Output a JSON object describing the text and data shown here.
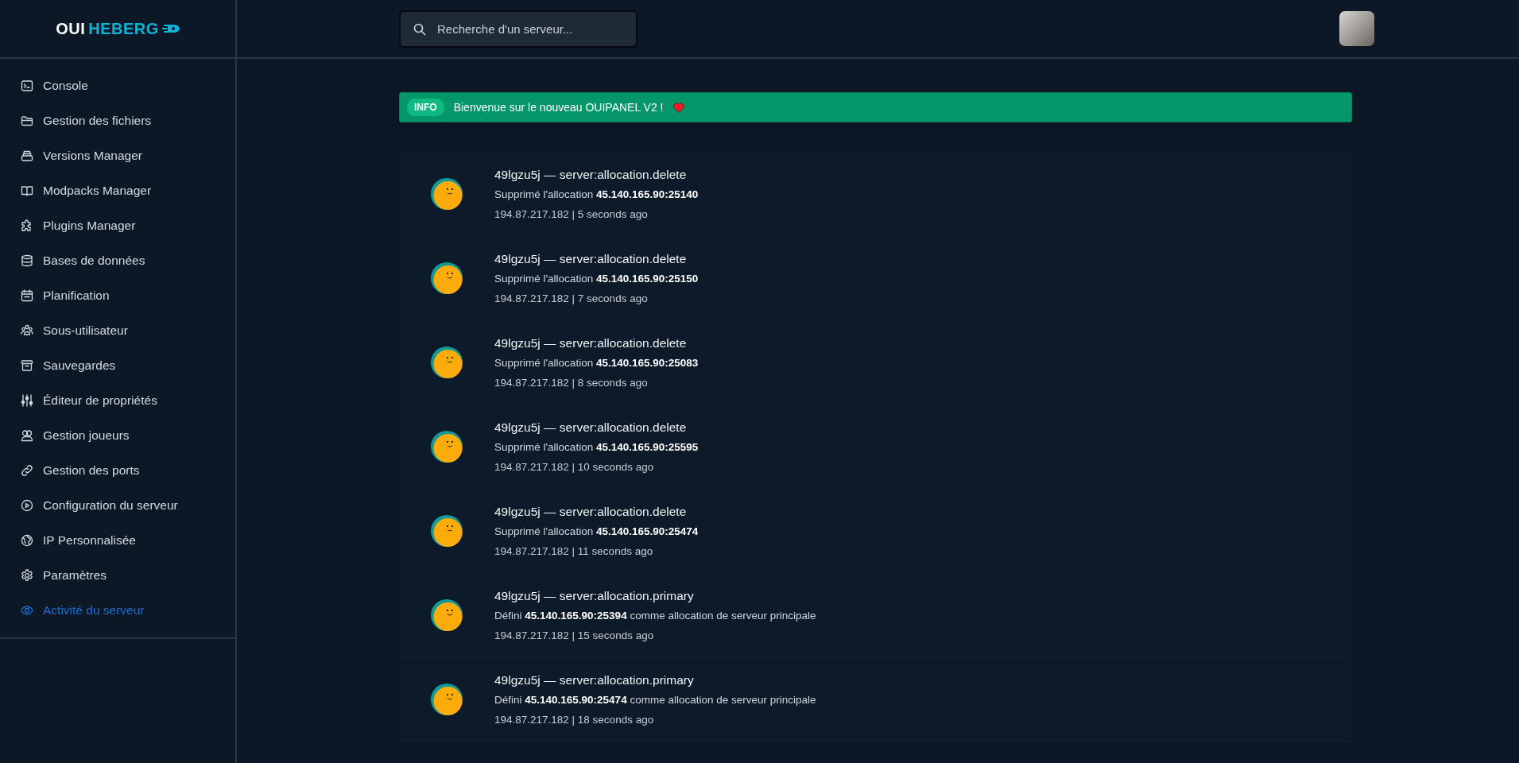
{
  "logo": {
    "part_1": "OUI",
    "part_2": "HEBERG"
  },
  "sidebar": {
    "items": [
      {
        "label": "Console",
        "selected": false
      },
      {
        "label": "Gestion des fichiers",
        "selected": false
      },
      {
        "label": "Versions Manager",
        "selected": false
      },
      {
        "label": "Modpacks Manager",
        "selected": false
      },
      {
        "label": "Plugins Manager",
        "selected": false
      },
      {
        "label": "Bases de données",
        "selected": false
      },
      {
        "label": "Planification",
        "selected": false
      },
      {
        "label": "Sous-utilisateur",
        "selected": false
      },
      {
        "label": "Sauvegardes",
        "selected": false
      },
      {
        "label": "Éditeur de propriétés",
        "selected": false
      },
      {
        "label": "Gestion joueurs",
        "selected": false
      },
      {
        "label": "Gestion des ports",
        "selected": false
      },
      {
        "label": "Configuration du serveur",
        "selected": false
      },
      {
        "label": "IP Personnalisée",
        "selected": false
      },
      {
        "label": "Paramètres",
        "selected": false
      },
      {
        "label": "Activité du serveur",
        "selected": true
      }
    ]
  },
  "search": {
    "placeholder": "Recherche d'un serveur..."
  },
  "alert": {
    "badge": "INFO",
    "message": "Bienvenue sur le nouveau OUIPANEL V2 !"
  },
  "activity": [
    {
      "title": "49lgzu5j — server:allocation.delete",
      "description": "Supprimé l'allocation **45.140.165.90:25140**",
      "meta": "194.87.217.182 | 5 seconds ago"
    },
    {
      "title": "49lgzu5j — server:allocation.delete",
      "description": "Supprimé l'allocation **45.140.165.90:25150**",
      "meta": "194.87.217.182 | 7 seconds ago"
    },
    {
      "title": "49lgzu5j — server:allocation.delete",
      "description": "Supprimé l'allocation **45.140.165.90:25083**",
      "meta": "194.87.217.182 | 8 seconds ago"
    },
    {
      "title": "49lgzu5j — server:allocation.delete",
      "description": "Supprimé l'allocation **45.140.165.90:25595**",
      "meta": "194.87.217.182 | 10 seconds ago"
    },
    {
      "title": "49lgzu5j — server:allocation.delete",
      "description": "Supprimé l'allocation **45.140.165.90:25474**",
      "meta": "194.87.217.182 | 11 seconds ago"
    },
    {
      "title": "49lgzu5j — server:allocation.primary",
      "description": "Défini **45.140.165.90:25394** comme allocation de serveur principale",
      "meta": "194.87.217.182 | 15 seconds ago"
    },
    {
      "title": "49lgzu5j — server:allocation.primary",
      "description": "Défini **45.140.165.90:25474** comme allocation de serveur principale",
      "meta": "194.87.217.182 | 18 seconds ago"
    }
  ]
}
